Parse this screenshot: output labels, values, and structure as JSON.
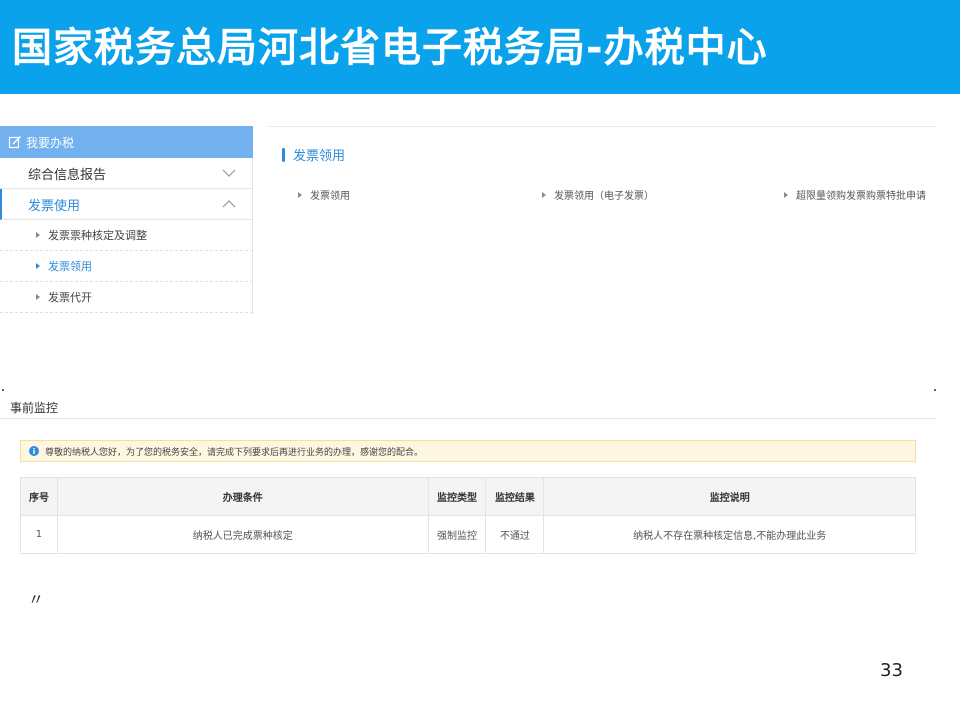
{
  "banner": {
    "title": "国家税务总局河北省电子税务局-办税中心"
  },
  "sidebar": {
    "header": "我要办税",
    "items": [
      {
        "label": "综合信息报告",
        "expanded": false
      },
      {
        "label": "发票使用",
        "expanded": true
      }
    ],
    "subitems": [
      {
        "label": "发票票种核定及调整"
      },
      {
        "label": "发票领用"
      },
      {
        "label": "发票代开"
      }
    ]
  },
  "content": {
    "section_title": "发票领用",
    "links": [
      "发票领用",
      "发票领用（电子发票）",
      "超限量领购发票购票特批申请"
    ]
  },
  "monitor": {
    "title": "事前监控",
    "notice": "尊敬的纳税人您好，为了您的税务安全，请完成下列要求后再进行业务的办理，感谢您的配合。",
    "columns": [
      "序号",
      "办理条件",
      "监控类型",
      "监控结果",
      "监控说明"
    ],
    "rows": [
      [
        "1",
        "纳税人已完成票种核定",
        "强制监控",
        "不通过",
        "纳税人不存在票种核定信息,不能办理此业务"
      ]
    ]
  },
  "footer": {
    "quote_mark": "〃",
    "page_number": "33"
  },
  "colors": {
    "banner": "#0aa2ea",
    "sidebar_header": "#73b1ee",
    "accent": "#2c8bdc",
    "fail": "#e02020"
  },
  "icons": {
    "sidebar_header": "edit-icon",
    "collapsed": "chevron-down-icon",
    "expanded": "chevron-up-icon",
    "notice": "info-icon"
  }
}
